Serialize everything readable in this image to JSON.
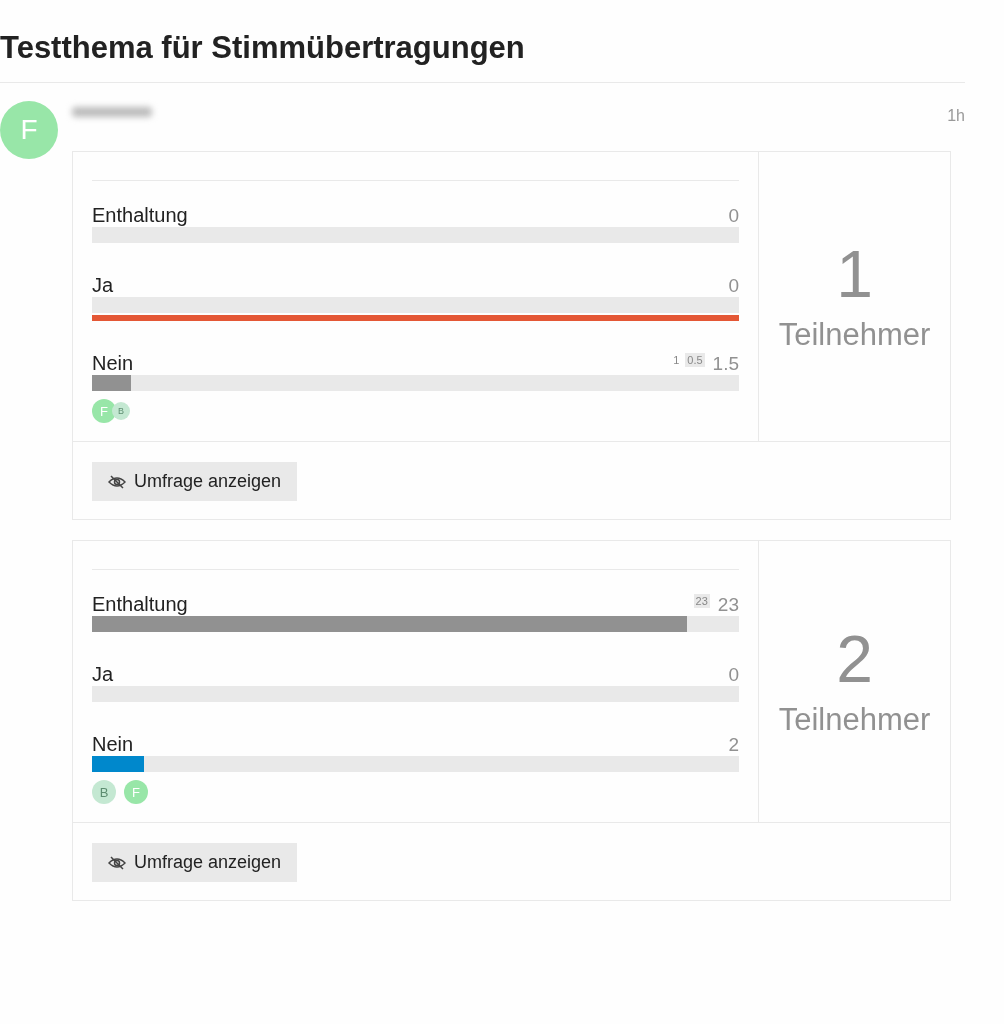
{
  "topic_title": "Testthema für Stimmübertragungen",
  "post": {
    "avatar_letter": "F",
    "username_blurred": true,
    "time": "1h"
  },
  "polls": [
    {
      "overlap_voters": true,
      "count": "1",
      "count_label": "Teilnehmer",
      "button": "Umfrage anzeigen",
      "options": [
        {
          "label": "Enthaltung",
          "value": "0",
          "level": 0,
          "color": "#919191",
          "highlight": false
        },
        {
          "label": "Ja",
          "value": "0",
          "level": 0,
          "color": "#919191",
          "highlight": true
        },
        {
          "label": "Nein",
          "value": "1.5",
          "level": 0.06,
          "color": "#919191",
          "highlight": false,
          "notes": [
            {
              "text": "1",
              "boxed": false
            },
            {
              "text": "0.5",
              "boxed": true
            }
          ],
          "voters": [
            {
              "letter": "F",
              "faded": false
            },
            {
              "letter": "B",
              "faded": true
            }
          ]
        }
      ]
    },
    {
      "overlap_voters": false,
      "count": "2",
      "count_label": "Teilnehmer",
      "button": "Umfrage anzeigen",
      "options": [
        {
          "label": "Enthaltung",
          "value": "23",
          "level": 0.92,
          "color": "#919191",
          "highlight": false,
          "notes": [
            {
              "text": "23",
              "boxed": true
            }
          ]
        },
        {
          "label": "Ja",
          "value": "0",
          "level": 0,
          "color": "#919191",
          "highlight": false
        },
        {
          "label": "Nein",
          "value": "2",
          "level": 0.08,
          "color": "#0088cc",
          "highlight": false,
          "voters": [
            {
              "letter": "B",
              "faded": true
            },
            {
              "letter": "F",
              "faded": false
            }
          ]
        }
      ]
    }
  ]
}
